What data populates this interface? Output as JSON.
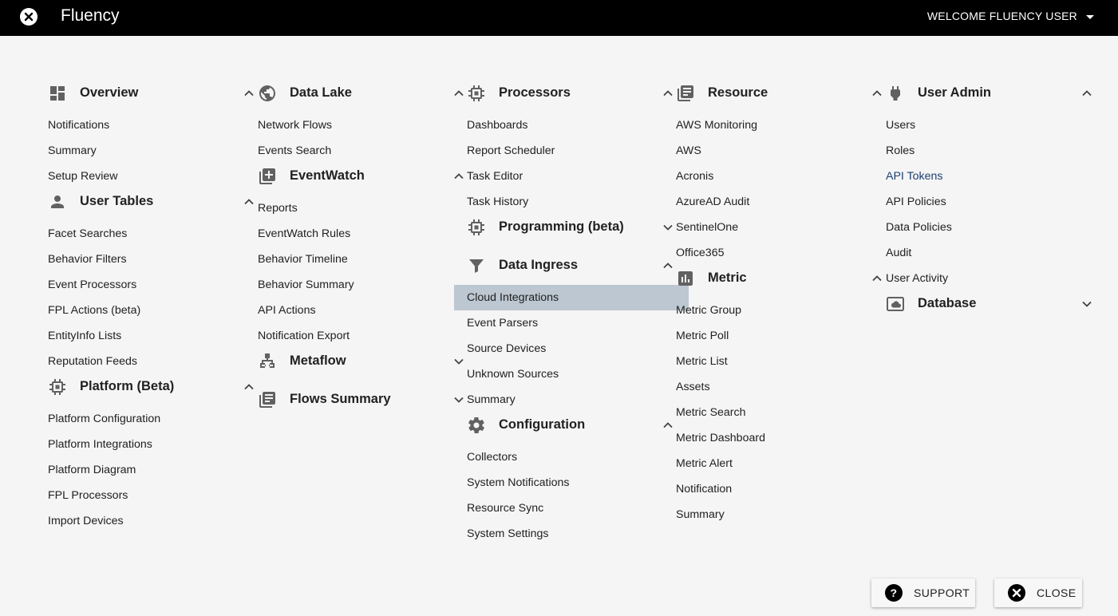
{
  "header": {
    "title": "Fluency",
    "user_label": "WELCOME FLUENCY USER"
  },
  "columns": [
    {
      "sections": [
        {
          "title": "Overview",
          "icon": "dashboard-icon",
          "expanded": true,
          "items": [
            "Notifications",
            "Summary",
            "Setup Review"
          ]
        },
        {
          "title": "User Tables",
          "icon": "person-icon",
          "expanded": true,
          "items": [
            "Facet Searches",
            "Behavior Filters",
            "Event Processors",
            "FPL Actions (beta)",
            "EntityInfo Lists",
            "Reputation Feeds"
          ]
        },
        {
          "title": "Platform (Beta)",
          "icon": "chip-icon",
          "expanded": true,
          "items": [
            "Platform Configuration",
            "Platform Integrations",
            "Platform Diagram",
            "FPL Processors",
            "Import Devices"
          ]
        }
      ]
    },
    {
      "sections": [
        {
          "title": "Data Lake",
          "icon": "globe-icon",
          "expanded": true,
          "items": [
            "Network Flows",
            "Events Search"
          ]
        },
        {
          "title": "EventWatch",
          "icon": "library-add-icon",
          "expanded": true,
          "items": [
            "Reports",
            "EventWatch Rules",
            "Behavior Timeline",
            "Behavior Summary",
            "API Actions",
            "Notification Export"
          ]
        },
        {
          "title": "Metaflow",
          "icon": "sitemap-icon",
          "expanded": false,
          "items": []
        },
        {
          "title": "Flows Summary",
          "icon": "library-books-icon",
          "expanded": false,
          "items": []
        }
      ]
    },
    {
      "sections": [
        {
          "title": "Processors",
          "icon": "chip-icon",
          "expanded": true,
          "items": [
            "Dashboards",
            "Report Scheduler",
            "Task Editor",
            "Task History"
          ]
        },
        {
          "title": "Programming (beta)",
          "icon": "chip-icon",
          "expanded": false,
          "items": []
        },
        {
          "title": "Data Ingress",
          "icon": "filter-icon",
          "expanded": true,
          "items": [
            "Cloud Integrations",
            "Event Parsers",
            "Source Devices",
            "Unknown Sources",
            "Summary"
          ]
        },
        {
          "title": "Configuration",
          "icon": "gear-icon",
          "expanded": true,
          "items": [
            "Collectors",
            "System Notifications",
            "Resource Sync",
            "System Settings"
          ]
        }
      ]
    },
    {
      "sections": [
        {
          "title": "Resource",
          "icon": "library-books-icon",
          "expanded": true,
          "items": [
            "AWS Monitoring",
            "AWS",
            "Acronis",
            "AzureAD Audit",
            "SentinelOne",
            "Office365"
          ]
        },
        {
          "title": "Metric",
          "icon": "bar-chart-icon",
          "expanded": true,
          "items": [
            "Metric Group",
            "Metric Poll",
            "Metric List",
            "Assets",
            "Metric Search",
            "Metric Dashboard",
            "Metric Alert",
            "Notification",
            "Summary"
          ]
        }
      ]
    },
    {
      "sections": [
        {
          "title": "User Admin",
          "icon": "plug-icon",
          "expanded": true,
          "items": [
            "Users",
            "Roles",
            "API Tokens",
            "API Policies",
            "Data Policies",
            "Audit",
            "User Activity"
          ]
        },
        {
          "title": "Database",
          "icon": "cloud-box-icon",
          "expanded": false,
          "items": []
        }
      ]
    }
  ],
  "selected_item": "Cloud Integrations",
  "active_item": "API Tokens",
  "footer": {
    "support_label": "SUPPORT",
    "close_label": "CLOSE"
  },
  "colors": {
    "topbar": "#000000",
    "background": "#f5f5f5",
    "selected_bg": "#bcc7d1",
    "active_text": "#1d3f72"
  }
}
